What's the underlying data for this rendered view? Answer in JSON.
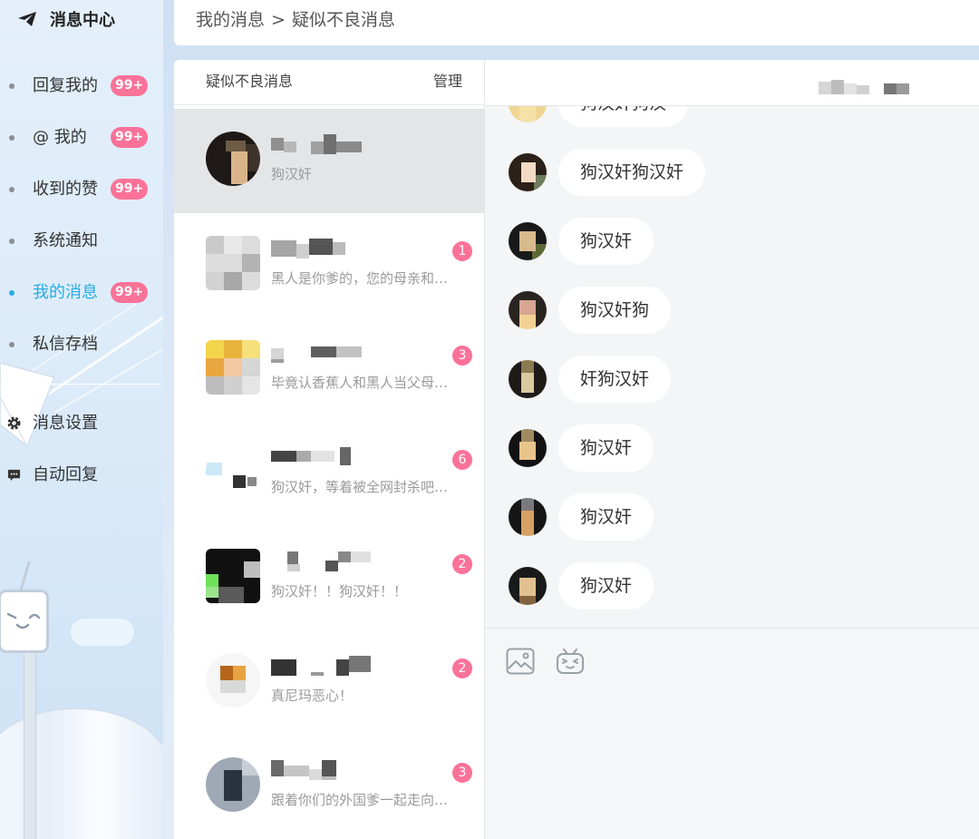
{
  "sidebar": {
    "title": "消息中心",
    "title_icon": "paper-plane-icon",
    "nav": [
      {
        "label": "回复我的",
        "badge": "99+"
      },
      {
        "label": "@ 我的",
        "badge": "99+"
      },
      {
        "label": "收到的赞",
        "badge": "99+"
      },
      {
        "label": "系统通知"
      },
      {
        "label": "我的消息",
        "badge": "99+",
        "active": true
      },
      {
        "label": "私信存档"
      }
    ],
    "settings": [
      {
        "label": "消息设置",
        "icon": "gear-icon"
      },
      {
        "label": "自动回复",
        "icon": "chat-bubble-icon"
      }
    ]
  },
  "breadcrumb": {
    "parent": "我的消息",
    "separator": ">",
    "current": "疑似不良消息"
  },
  "conversation_list": {
    "title": "疑似不良消息",
    "manage_label": "管理",
    "items": [
      {
        "preview": "狗汉奸",
        "selected": true
      },
      {
        "preview": "黑人是你爹的，您的母亲和…",
        "unread": "1"
      },
      {
        "preview": "毕竟认香蕉人和黑人当父母…",
        "unread": "3"
      },
      {
        "preview": "狗汉奸，等着被全网封杀吧…",
        "unread": "6"
      },
      {
        "preview": "狗汉奸！！狗汉奸！！",
        "unread": "2"
      },
      {
        "preview": "真尼玛恶心！",
        "unread": "2"
      },
      {
        "preview": "跟着你们的外国爹一起走向…",
        "unread": "3"
      }
    ]
  },
  "chat": {
    "messages": [
      "狗汉奸狗汉",
      "狗汉奸狗汉奸",
      "狗汉奸",
      "狗汉奸狗",
      "奸狗汉奸",
      "狗汉奸",
      "狗汉奸",
      "狗汉奸"
    ],
    "toolbar_icons": [
      "image-icon",
      "emoji-tv-icon"
    ]
  },
  "colors": {
    "badge_pink": "#fb7299",
    "active_blue": "#23ade5",
    "selected_row": "#e4e5e7",
    "chat_background": "#f4f5f7"
  }
}
